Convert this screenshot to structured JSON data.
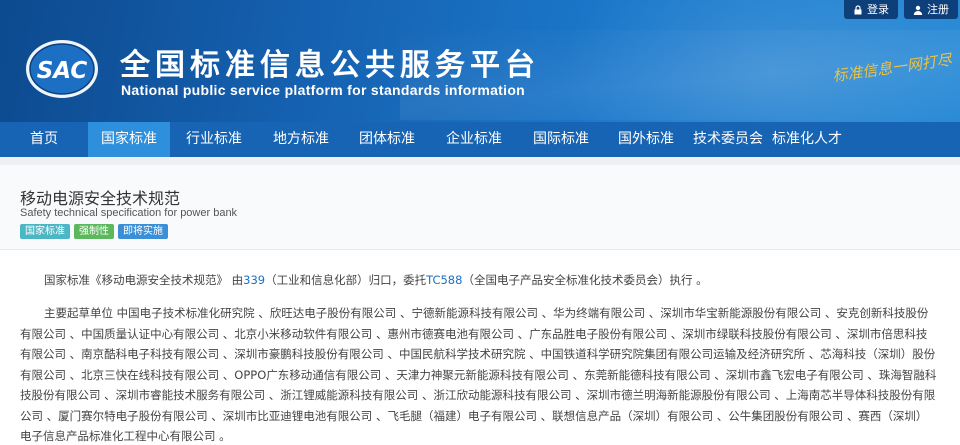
{
  "topbar": {
    "login": "登录",
    "register": "注册"
  },
  "header": {
    "logo_text": "SAC",
    "title": "全国标准信息公共服务平台",
    "subtitle": "National public service platform  for standards information",
    "slogan": "标准信息一网打尽"
  },
  "nav": [
    {
      "label": "首页"
    },
    {
      "label": "国家标准"
    },
    {
      "label": "行业标准"
    },
    {
      "label": "地方标准"
    },
    {
      "label": "团体标准"
    },
    {
      "label": "企业标准"
    },
    {
      "label": "国际标准"
    },
    {
      "label": "国外标准"
    },
    {
      "label": "技术委员会"
    },
    {
      "label": "标准化人才"
    }
  ],
  "nav_active_index": 1,
  "standard": {
    "title": "移动电源安全技术规范",
    "title_en": "Safety technical specification for power bank",
    "tags": [
      "国家标准",
      "强制性",
      "即将实施"
    ]
  },
  "para1": {
    "prefix": "国家标准《移动电源安全技术规范》 由",
    "code1": "339",
    "mid": "（工业和信息化部）归口，委托",
    "code2": "TC588",
    "suffix": "（全国电子产品安全标准化技术委员会）执行 。"
  },
  "para2": "主要起草单位 中国电子技术标准化研究院 、欣旺达电子股份有限公司 、宁德新能源科技有限公司 、华为终端有限公司 、深圳市华宝新能源股份有限公司 、安克创新科技股份有限公司 、中国质量认证中心有限公司 、北京小米移动软件有限公司 、惠州市德赛电池有限公司 、广东品胜电子股份有限公司 、深圳市绿联科技股份有限公司 、深圳市倍思科技有限公司 、南京酷科电子科技有限公司 、深圳市豪鹏科技股份有限公司 、中国民航科学技术研究院 、中国铁道科学研究院集团有限公司运输及经济研究所 、芯海科技（深圳）股份有限公司 、北京三快在线科技有限公司 、OPPO广东移动通信有限公司 、天津力神聚元新能源科技有限公司 、东莞新能德科技有限公司 、深圳市鑫飞宏电子有限公司 、珠海智融科技股份有限公司 、深圳市睿能技术服务有限公司 、浙江锂威能源科技有限公司 、浙江欣动能源科技有限公司 、深圳市德兰明海新能源股份有限公司 、上海南芯半导体科技股份有限公司 、厦门赛尔特电子股份有限公司 、深圳市比亚迪锂电池有限公司 、飞毛腿（福建）电子有限公司 、联想信息产品（深圳）有限公司 、公牛集团股份有限公司 、赛西（深圳）电子信息产品标准化工程中心有限公司 。"
}
